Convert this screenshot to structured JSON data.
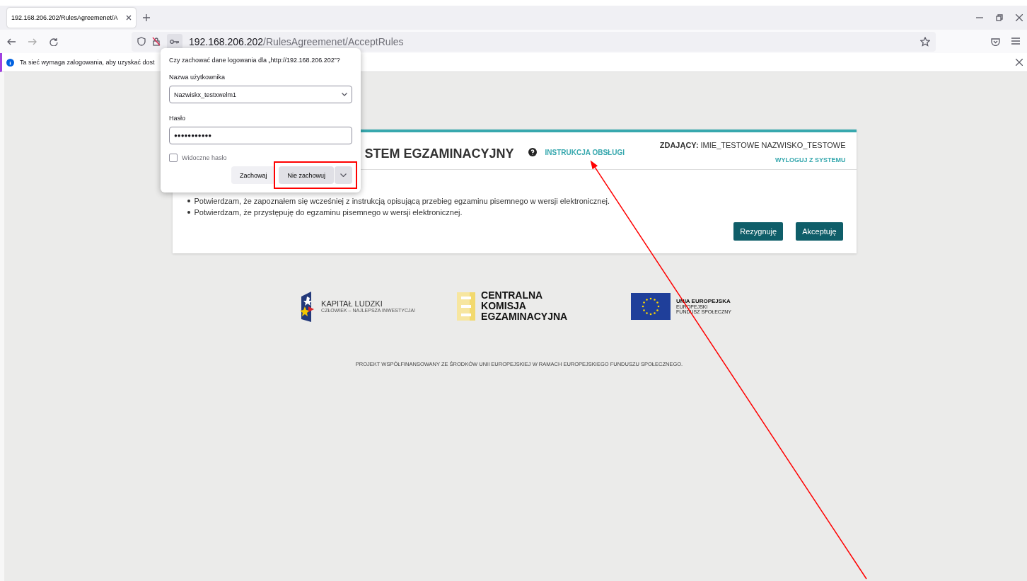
{
  "browser": {
    "tabs": [
      {
        "title": "192.168.206.202/RulesAgreemenet/A",
        "selected": true
      }
    ],
    "url_host": "192.168.206.202",
    "url_path": "/RulesAgreemenet/AcceptRules"
  },
  "notification": {
    "text": "Ta sieć wymaga zalogowania, aby uzyskać dost"
  },
  "password_prompt": {
    "question": "Czy zachować dane logowania dla „http://192.168.206.202”?",
    "username_label": "Nazwa użytkownika",
    "username": "Nazwiskx_testxwelm1",
    "password_label": "Hasło",
    "password": "●●●●●●●●●●●",
    "show_password": {
      "label": "Widoczne hasło",
      "checked": false
    },
    "buttons": [
      {
        "label": "Zachowaj",
        "highlighted": false
      },
      {
        "label": "Nie zachowuj",
        "highlighted": true
      }
    ]
  },
  "page": {
    "title": "STEM EGZAMINACYJNY",
    "help_link": "INSTRUKCJA OBSŁUGI",
    "help_link_arrow": true,
    "candidate_label": "ZDAJĄCY:",
    "candidate_name": "IMIE_TESTOWE NAZWISKO_TESTOWE",
    "logout_link": "WYLOGUJ Z SYSTEMU",
    "statements": [
      "Potwierdzam, że zapoznałem się wcześniej z instrukcją opisującą przebieg egzaminu pisemnego w wersji elektronicznej.",
      "Potwierdzam, że przystępuję do egzaminu pisemnego w wersji elektronicznej."
    ],
    "buttons": [
      "Rezygnuję",
      "Akceptuję"
    ]
  },
  "logos": [
    {
      "kind": "kapital",
      "lines": [
        "KAPITAŁ LUDZKI",
        "CZŁOWIEK – NAJLEPSZA INWESTYCJA!"
      ]
    },
    {
      "kind": "cke",
      "lines": [
        "CENTRALNA",
        "KOMISJA",
        "EGZAMINACYJNA"
      ]
    },
    {
      "kind": "eu",
      "lines": [
        "UNIA EUROPEJSKA",
        "EUROPEJSKI",
        "FUNDUSZ SPOŁECZNY"
      ]
    }
  ],
  "footer": "PROJEKT WSPÓŁFINANSOWANY ZE ŚRODKÓW UNII EUROPEJSKIEJ W RAMACH EUROPEJSKIEGO FUNDUSZU SPOŁECZNEGO."
}
